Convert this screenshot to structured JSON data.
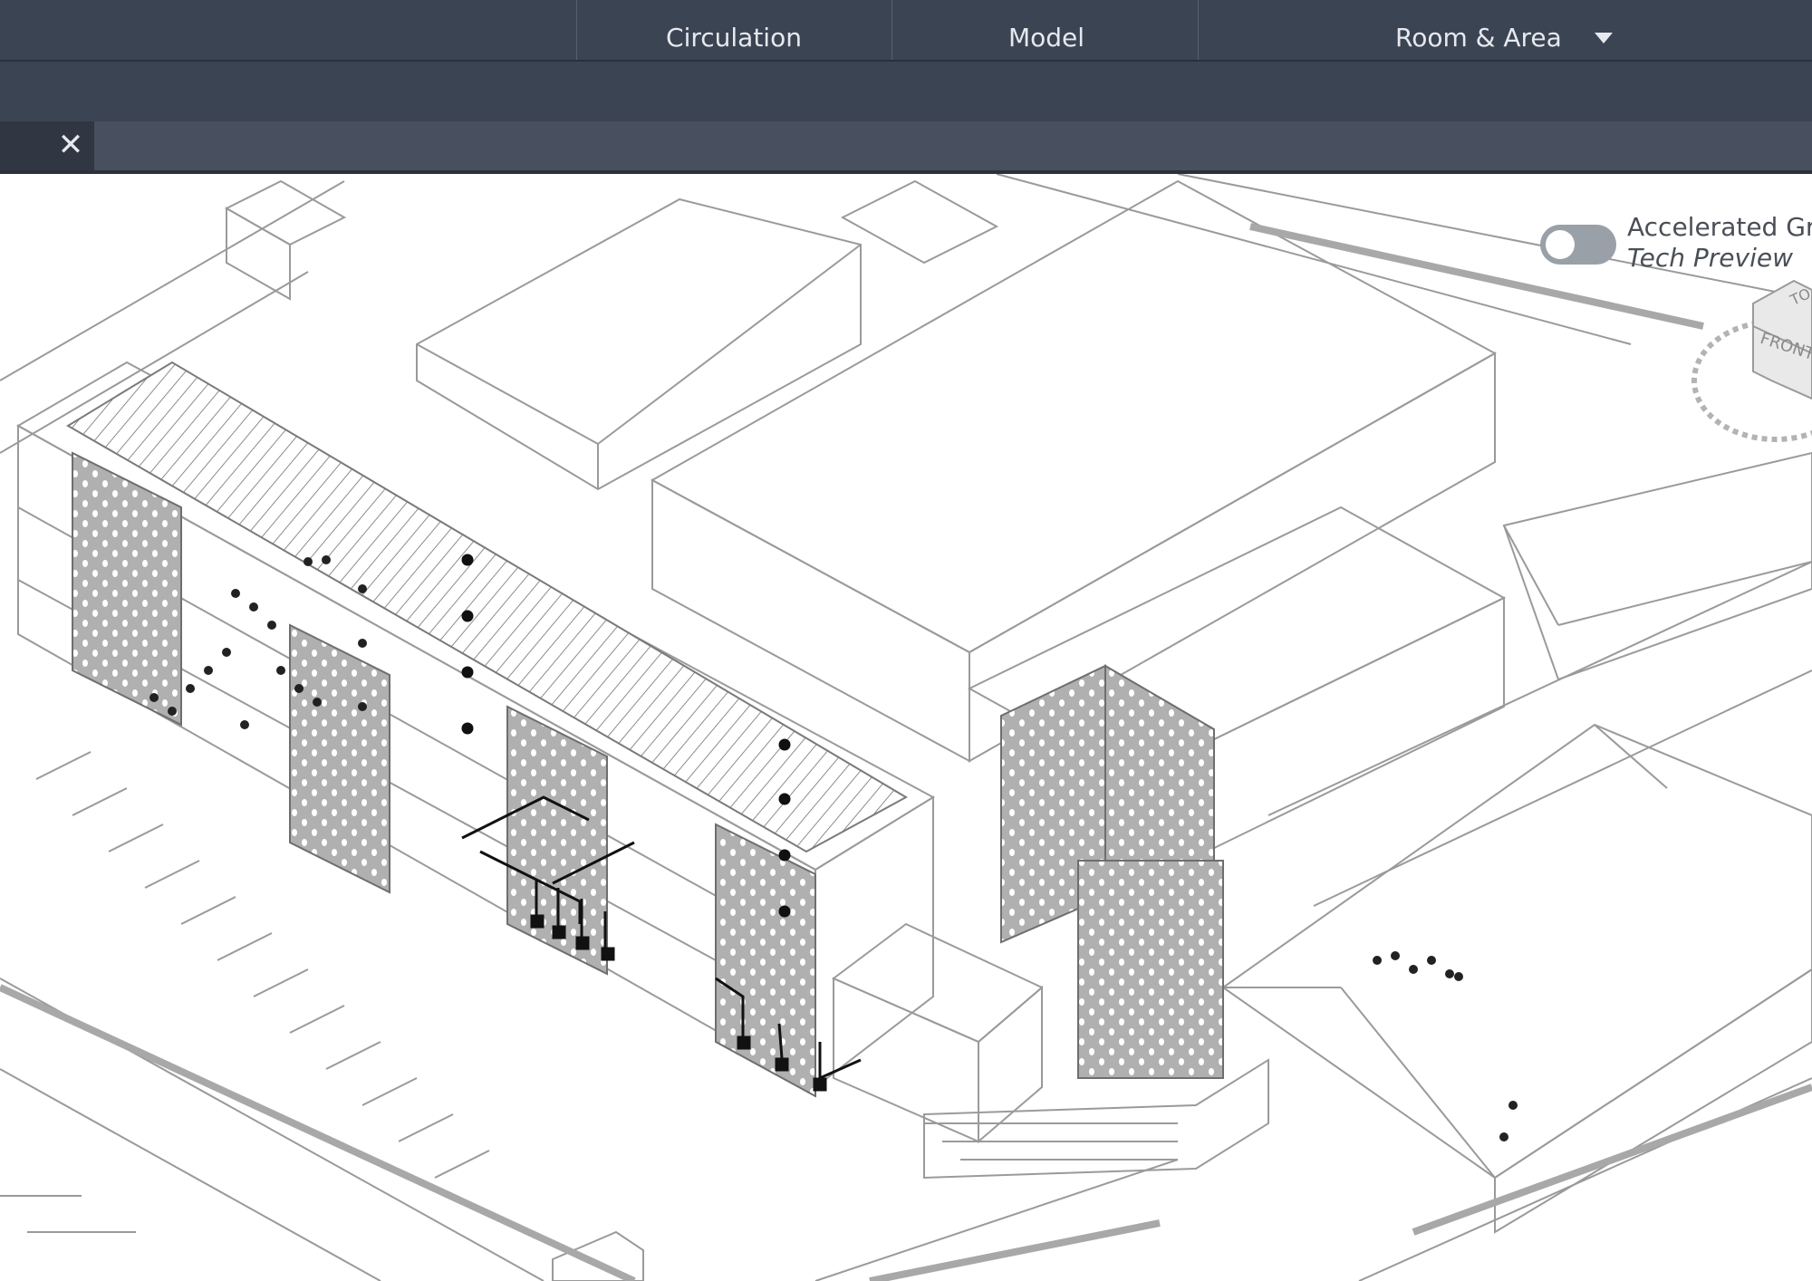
{
  "ribbon": {
    "panels": [
      {
        "label": "Circulation"
      },
      {
        "label": "Model"
      },
      {
        "label": "Room & Area"
      }
    ],
    "dropdown_icon": "caret-down-icon"
  },
  "tabs": [
    {
      "close_icon": "close-icon"
    }
  ],
  "viewport": {
    "graphics_toggle": {
      "label": "Accelerated Gra",
      "sublabel": "Tech Preview",
      "state": "off"
    },
    "viewcube": {
      "face_label": "FRONT",
      "top_label": "TO"
    }
  },
  "colors": {
    "ribbon_bg": "#3b4453",
    "tabbar_bg": "#48505f",
    "text": "#e6e9ee",
    "panel_gray": "#b3b3b3",
    "line_gray": "#9a9a9a"
  }
}
